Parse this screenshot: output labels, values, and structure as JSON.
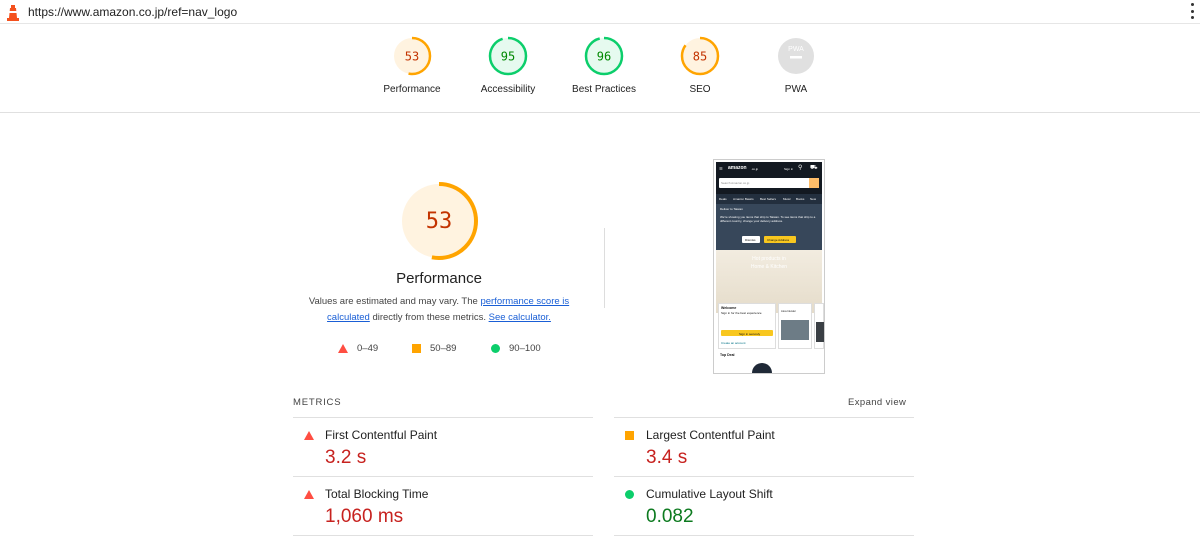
{
  "browser": {
    "url": "https://www.amazon.co.jp/ref=nav_logo"
  },
  "gauges": [
    {
      "score": "53",
      "label": "Performance",
      "fraction": 0.53,
      "color": "#ffa400",
      "bg": "#fff3e0",
      "text_color": "#c33300"
    },
    {
      "score": "95",
      "label": "Accessibility",
      "fraction": 0.95,
      "color": "#0cce6b",
      "bg": "#e6faef",
      "text_color": "#008800"
    },
    {
      "score": "96",
      "label": "Best Practices",
      "fraction": 0.96,
      "color": "#0cce6b",
      "bg": "#e6faef",
      "text_color": "#008800"
    },
    {
      "score": "85",
      "label": "SEO",
      "fraction": 0.85,
      "color": "#ffa400",
      "bg": "#fff3e0",
      "text_color": "#c33300"
    },
    {
      "score": "PWA",
      "label": "PWA",
      "fraction": 0,
      "color": "#cccccc",
      "bg": "#e0e0e0",
      "text_color": "#ffffff"
    }
  ],
  "performance": {
    "score": "53",
    "fraction": 0.53,
    "title": "Performance",
    "desc_1": "Values are estimated and may vary. The ",
    "desc_link_1": "performance score is calculated",
    "desc_2": " directly from these metrics. ",
    "desc_link_2": "See calculator."
  },
  "legend": [
    {
      "icon": "triangle-icon",
      "range": "0–49",
      "color": "#ff4e42"
    },
    {
      "icon": "square-icon",
      "range": "50–89",
      "color": "#ffa400"
    },
    {
      "icon": "circle-icon",
      "range": "90–100",
      "color": "#0cce6b"
    }
  ],
  "screenshot": {
    "logo": "amazon",
    "logo_suffix": ".co.jp",
    "sign_in": "Sign in",
    "search_placeholder": "Search Amazon.co.jp",
    "nav_links": [
      "Deals",
      "Amazon Basics",
      "Best Sellers",
      "Music",
      "Books",
      "New"
    ],
    "deliver": "Deliver to Taiwan",
    "notice": "We're showing you items that ship to Taiwan. To see items that ship to a different country, change your delivery address.",
    "dismiss": "Dismiss",
    "change": "Change Address",
    "hero_1": "Hot products in",
    "hero_2": "Home & Kitchen",
    "card_title": "Welcome",
    "card_sub": "Sign in for the best experience",
    "card_button": "Sign in securely",
    "card_link": "Create an account",
    "card2_text": "Juice blender",
    "top_deal": "Top Deal"
  },
  "metrics": {
    "heading": "METRICS",
    "expand": "Expand view",
    "items": [
      {
        "name": "First Contentful Paint",
        "value": "3.2 s",
        "icon": "triangle-icon",
        "status": "fail"
      },
      {
        "name": "Largest Contentful Paint",
        "value": "3.4 s",
        "icon": "square-icon",
        "status": "average"
      },
      {
        "name": "Total Blocking Time",
        "value": "1,060 ms",
        "icon": "triangle-icon",
        "status": "fail"
      },
      {
        "name": "Cumulative Layout Shift",
        "value": "0.082",
        "icon": "circle-icon",
        "status": "pass"
      }
    ]
  }
}
